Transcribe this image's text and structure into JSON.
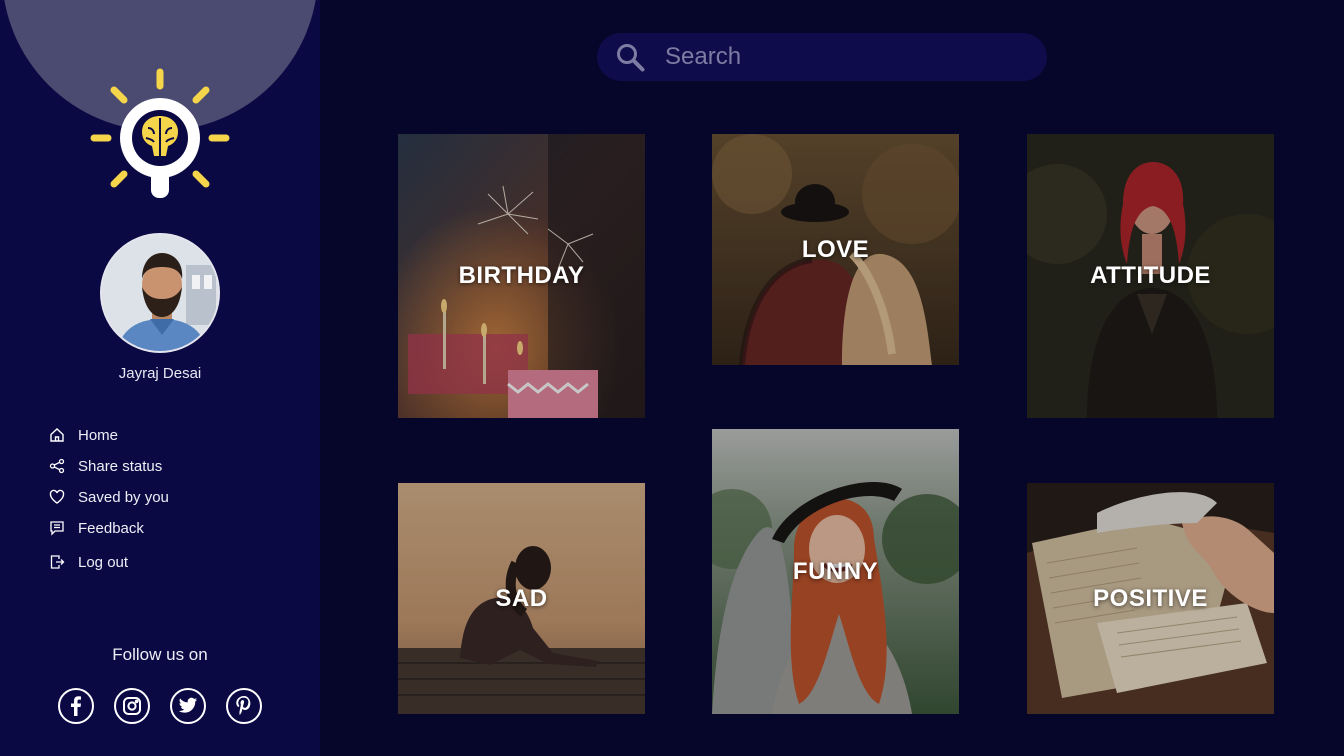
{
  "search": {
    "placeholder": "Search",
    "value": ""
  },
  "profile": {
    "name": "Jayraj Desai"
  },
  "nav": [
    {
      "label": "Home",
      "icon": "home-icon"
    },
    {
      "label": "Share status",
      "icon": "share-icon"
    },
    {
      "label": "Saved by you",
      "icon": "heart-icon"
    },
    {
      "label": "Feedback",
      "icon": "feedback-icon"
    },
    {
      "label": "Log out",
      "icon": "logout-icon"
    }
  ],
  "follow": {
    "label": "Follow us on"
  },
  "socials": [
    "facebook-icon",
    "instagram-icon",
    "twitter-icon",
    "pinterest-icon"
  ],
  "categories": [
    {
      "label": "BIRTHDAY"
    },
    {
      "label": "LOVE"
    },
    {
      "label": "ATTITUDE"
    },
    {
      "label": "SAD"
    },
    {
      "label": "FUNNY"
    },
    {
      "label": "POSITIVE"
    }
  ],
  "colors": {
    "background": "#06052a",
    "sidebar": "#0b0944",
    "accent": "#f5d54a",
    "search_bg": "#0e0c4a"
  }
}
